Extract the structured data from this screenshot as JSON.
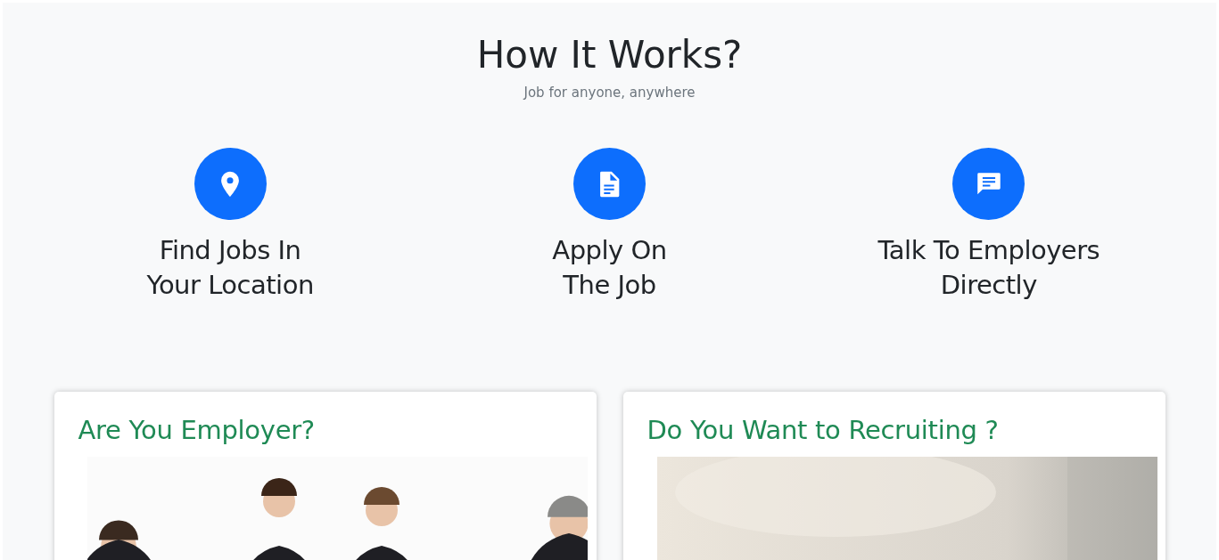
{
  "section": {
    "title": "How It Works?",
    "subtitle": "Job for anyone, anywhere"
  },
  "steps": [
    {
      "kind": "location",
      "lines": [
        "Find Jobs In",
        "Your Location"
      ]
    },
    {
      "kind": "document",
      "lines": [
        "Apply On",
        "The Job"
      ]
    },
    {
      "kind": "chat",
      "lines": [
        "Talk To Employers",
        "Directly"
      ]
    }
  ],
  "cards": [
    {
      "title": "Are You Employer?",
      "kind": "picture"
    },
    {
      "title": "Do You Want to Recruiting ?",
      "kind": "picture"
    }
  ]
}
